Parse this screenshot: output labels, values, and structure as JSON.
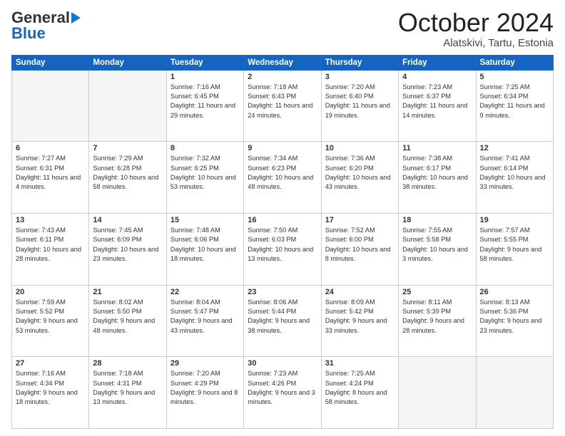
{
  "header": {
    "logo_general": "General",
    "logo_blue": "Blue",
    "month_title": "October 2024",
    "location": "Alatskivi, Tartu, Estonia"
  },
  "days_of_week": [
    "Sunday",
    "Monday",
    "Tuesday",
    "Wednesday",
    "Thursday",
    "Friday",
    "Saturday"
  ],
  "weeks": [
    [
      {
        "day": "",
        "info": ""
      },
      {
        "day": "",
        "info": ""
      },
      {
        "day": "1",
        "info": "Sunrise: 7:16 AM\nSunset: 6:45 PM\nDaylight: 11 hours\nand 29 minutes."
      },
      {
        "day": "2",
        "info": "Sunrise: 7:18 AM\nSunset: 6:43 PM\nDaylight: 11 hours\nand 24 minutes."
      },
      {
        "day": "3",
        "info": "Sunrise: 7:20 AM\nSunset: 6:40 PM\nDaylight: 11 hours\nand 19 minutes."
      },
      {
        "day": "4",
        "info": "Sunrise: 7:23 AM\nSunset: 6:37 PM\nDaylight: 11 hours\nand 14 minutes."
      },
      {
        "day": "5",
        "info": "Sunrise: 7:25 AM\nSunset: 6:34 PM\nDaylight: 11 hours\nand 9 minutes."
      }
    ],
    [
      {
        "day": "6",
        "info": "Sunrise: 7:27 AM\nSunset: 6:31 PM\nDaylight: 11 hours\nand 4 minutes."
      },
      {
        "day": "7",
        "info": "Sunrise: 7:29 AM\nSunset: 6:28 PM\nDaylight: 10 hours\nand 58 minutes."
      },
      {
        "day": "8",
        "info": "Sunrise: 7:32 AM\nSunset: 6:25 PM\nDaylight: 10 hours\nand 53 minutes."
      },
      {
        "day": "9",
        "info": "Sunrise: 7:34 AM\nSunset: 6:23 PM\nDaylight: 10 hours\nand 48 minutes."
      },
      {
        "day": "10",
        "info": "Sunrise: 7:36 AM\nSunset: 6:20 PM\nDaylight: 10 hours\nand 43 minutes."
      },
      {
        "day": "11",
        "info": "Sunrise: 7:38 AM\nSunset: 6:17 PM\nDaylight: 10 hours\nand 38 minutes."
      },
      {
        "day": "12",
        "info": "Sunrise: 7:41 AM\nSunset: 6:14 PM\nDaylight: 10 hours\nand 33 minutes."
      }
    ],
    [
      {
        "day": "13",
        "info": "Sunrise: 7:43 AM\nSunset: 6:11 PM\nDaylight: 10 hours\nand 28 minutes."
      },
      {
        "day": "14",
        "info": "Sunrise: 7:45 AM\nSunset: 6:09 PM\nDaylight: 10 hours\nand 23 minutes."
      },
      {
        "day": "15",
        "info": "Sunrise: 7:48 AM\nSunset: 6:06 PM\nDaylight: 10 hours\nand 18 minutes."
      },
      {
        "day": "16",
        "info": "Sunrise: 7:50 AM\nSunset: 6:03 PM\nDaylight: 10 hours\nand 13 minutes."
      },
      {
        "day": "17",
        "info": "Sunrise: 7:52 AM\nSunset: 6:00 PM\nDaylight: 10 hours\nand 8 minutes."
      },
      {
        "day": "18",
        "info": "Sunrise: 7:55 AM\nSunset: 5:58 PM\nDaylight: 10 hours\nand 3 minutes."
      },
      {
        "day": "19",
        "info": "Sunrise: 7:57 AM\nSunset: 5:55 PM\nDaylight: 9 hours\nand 58 minutes."
      }
    ],
    [
      {
        "day": "20",
        "info": "Sunrise: 7:59 AM\nSunset: 5:52 PM\nDaylight: 9 hours\nand 53 minutes."
      },
      {
        "day": "21",
        "info": "Sunrise: 8:02 AM\nSunset: 5:50 PM\nDaylight: 9 hours\nand 48 minutes."
      },
      {
        "day": "22",
        "info": "Sunrise: 8:04 AM\nSunset: 5:47 PM\nDaylight: 9 hours\nand 43 minutes."
      },
      {
        "day": "23",
        "info": "Sunrise: 8:06 AM\nSunset: 5:44 PM\nDaylight: 9 hours\nand 38 minutes."
      },
      {
        "day": "24",
        "info": "Sunrise: 8:09 AM\nSunset: 5:42 PM\nDaylight: 9 hours\nand 33 minutes."
      },
      {
        "day": "25",
        "info": "Sunrise: 8:11 AM\nSunset: 5:39 PM\nDaylight: 9 hours\nand 28 minutes."
      },
      {
        "day": "26",
        "info": "Sunrise: 8:13 AM\nSunset: 5:36 PM\nDaylight: 9 hours\nand 23 minutes."
      }
    ],
    [
      {
        "day": "27",
        "info": "Sunrise: 7:16 AM\nSunset: 4:34 PM\nDaylight: 9 hours\nand 18 minutes."
      },
      {
        "day": "28",
        "info": "Sunrise: 7:18 AM\nSunset: 4:31 PM\nDaylight: 9 hours\nand 13 minutes."
      },
      {
        "day": "29",
        "info": "Sunrise: 7:20 AM\nSunset: 4:29 PM\nDaylight: 9 hours\nand 8 minutes."
      },
      {
        "day": "30",
        "info": "Sunrise: 7:23 AM\nSunset: 4:26 PM\nDaylight: 9 hours\nand 3 minutes."
      },
      {
        "day": "31",
        "info": "Sunrise: 7:25 AM\nSunset: 4:24 PM\nDaylight: 8 hours\nand 58 minutes."
      },
      {
        "day": "",
        "info": ""
      },
      {
        "day": "",
        "info": ""
      }
    ]
  ]
}
